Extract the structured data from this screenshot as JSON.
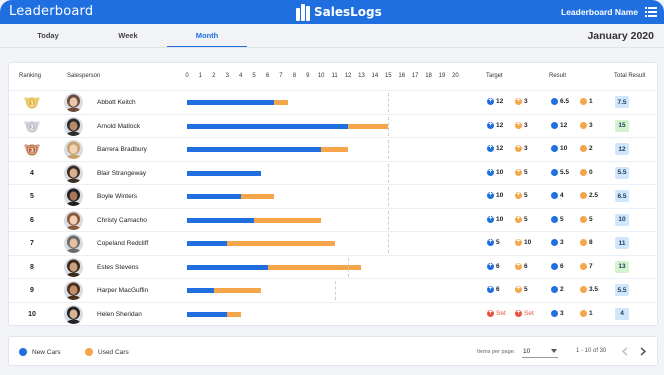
{
  "header": {
    "left_title": "Leaderboard",
    "brand": "SalesLogs",
    "right_title": "Leaderboard Name",
    "bar_color": "#1f6fe0"
  },
  "tabs": [
    {
      "label": "Today",
      "active": false
    },
    {
      "label": "Week",
      "active": false
    },
    {
      "label": "Month",
      "active": true
    }
  ],
  "period": "January 2020",
  "table": {
    "headers": {
      "ranking": "Ranking",
      "salesperson": "Salesperson",
      "target": "Target",
      "result": "Result",
      "total": "Total Result"
    },
    "scale_ticks": [
      "0",
      "1",
      "2",
      "3",
      "4",
      "5",
      "6",
      "7",
      "8",
      "9",
      "10",
      "11",
      "12",
      "13",
      "14",
      "15",
      "16",
      "17",
      "18",
      "19",
      "20"
    ],
    "rows": [
      {
        "rank": "1",
        "medal": "gold",
        "name": "Abbott Keitch",
        "target_new": "12",
        "target_used": "3",
        "result_new": "6.5",
        "result_used": "1",
        "total": "7.5",
        "badge_color": "#cfe6fb"
      },
      {
        "rank": "2",
        "medal": "silver",
        "name": "Arnold Matlock",
        "target_new": "12",
        "target_used": "3",
        "result_new": "12",
        "result_used": "3",
        "total": "15",
        "badge_color": "#d3f3cf"
      },
      {
        "rank": "3",
        "medal": "bronze",
        "name": "Barrera Bradbury",
        "target_new": "12",
        "target_used": "3",
        "result_new": "10",
        "result_used": "2",
        "total": "12",
        "badge_color": "#cfe6fb"
      },
      {
        "rank": "4",
        "medal": "",
        "name": "Blair Strangeway",
        "target_new": "10",
        "target_used": "5",
        "result_new": "5.5",
        "result_used": "0",
        "total": "5.5",
        "badge_color": "#cfe6fb"
      },
      {
        "rank": "5",
        "medal": "",
        "name": "Boyle Winters",
        "target_new": "10",
        "target_used": "5",
        "result_new": "4",
        "result_used": "2.5",
        "total": "6.5",
        "badge_color": "#cfe6fb"
      },
      {
        "rank": "6",
        "medal": "",
        "name": "Christy Camacho",
        "target_new": "10",
        "target_used": "5",
        "result_new": "5",
        "result_used": "5",
        "total": "10",
        "badge_color": "#cfe6fb"
      },
      {
        "rank": "7",
        "medal": "",
        "name": "Copeland Redcliff",
        "target_new": "5",
        "target_used": "10",
        "result_new": "3",
        "result_used": "8",
        "total": "11",
        "badge_color": "#cfe6fb"
      },
      {
        "rank": "8",
        "medal": "",
        "name": "Estes Stevens",
        "target_new": "6",
        "target_used": "6",
        "result_new": "6",
        "result_used": "7",
        "total": "13",
        "badge_color": "#d3f3cf"
      },
      {
        "rank": "9",
        "medal": "",
        "name": "Harper MacGuffin",
        "target_new": "6",
        "target_used": "5",
        "result_new": "2",
        "result_used": "3.5",
        "total": "5.5",
        "badge_color": "#cfe6fb"
      },
      {
        "rank": "10",
        "medal": "",
        "name": "Helen Sheridan",
        "target_new": "Set",
        "target_used": "Set",
        "result_new": "3",
        "result_used": "1",
        "total": "4",
        "badge_color": "#cfe6fb"
      }
    ]
  },
  "legend": {
    "new": "New Cars",
    "used": "Used Cars",
    "new_color": "#1f6fe0",
    "used_color": "#f5a54a"
  },
  "pagination": {
    "items_per_page_label": "Items per page:",
    "items_per_page": "10",
    "range": "1 - 10 of 30"
  }
}
